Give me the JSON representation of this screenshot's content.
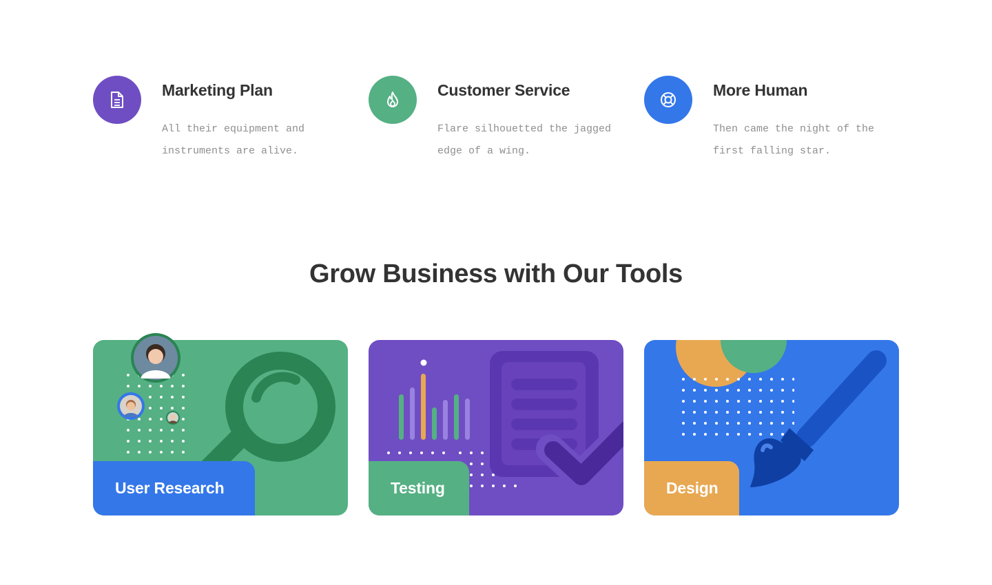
{
  "features": [
    {
      "title": "Marketing Plan",
      "description": "All their equipment and instruments are alive.",
      "icon": "document-icon",
      "color": "#6f4ec3"
    },
    {
      "title": "Customer Service",
      "description": "Flare silhouetted the jagged edge of a wing.",
      "icon": "flame-icon",
      "color": "#55b084"
    },
    {
      "title": "More Human",
      "description": "Then came the night of the first falling star.",
      "icon": "lifebuoy-icon",
      "color": "#3477e9"
    }
  ],
  "section": {
    "title": "Grow Business with Our Tools"
  },
  "cards": [
    {
      "label": "User Research",
      "background": "#55b084",
      "label_color": "#3477e9",
      "icon": "magnifier-icon"
    },
    {
      "label": "Testing",
      "background": "#6f4ec3",
      "label_color": "#55b084",
      "icon": "checklist-icon"
    },
    {
      "label": "Design",
      "background": "#3477e9",
      "label_color": "#e8a852",
      "icon": "paintbrush-icon"
    }
  ]
}
